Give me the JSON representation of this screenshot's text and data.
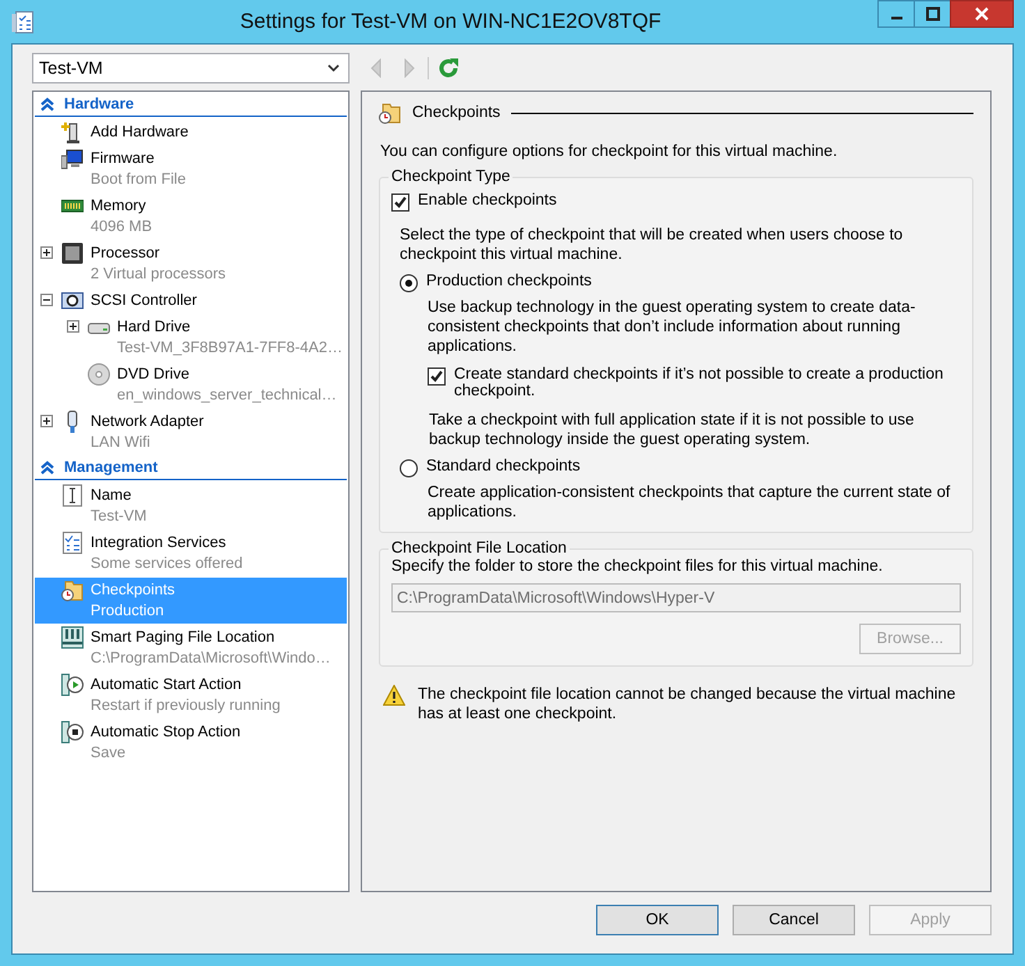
{
  "window": {
    "title": "Settings for Test-VM on WIN-NC1E2OV8TQF"
  },
  "vm_selector": {
    "value": "Test-VM"
  },
  "sidebar": {
    "sections": [
      {
        "title": "Hardware",
        "expanded": true,
        "items": [
          {
            "kind": "add",
            "label": "Add Hardware",
            "selected": false
          },
          {
            "kind": "firmware",
            "label": "Firmware",
            "detail": "Boot from File",
            "selected": false
          },
          {
            "kind": "memory",
            "label": "Memory",
            "detail": "4096 MB",
            "selected": false
          },
          {
            "kind": "processor",
            "label": "Processor",
            "detail": "2 Virtual processors",
            "selected": false,
            "expanded": false
          },
          {
            "kind": "controller",
            "label": "SCSI Controller",
            "selected": false,
            "expanded": true,
            "children": [
              {
                "kind": "disk",
                "label": "Hard Drive",
                "detail": "Test-VM_3F8B97A1-7FF8-4A2…",
                "selected": false,
                "expanded": false
              },
              {
                "kind": "dvd",
                "label": "DVD Drive",
                "detail": "en_windows_server_technical…",
                "selected": false
              }
            ]
          },
          {
            "kind": "network",
            "label": "Network Adapter",
            "detail": "LAN Wifi",
            "selected": false,
            "expanded": false
          }
        ]
      },
      {
        "title": "Management",
        "expanded": true,
        "items": [
          {
            "kind": "name",
            "label": "Name",
            "detail": "Test-VM",
            "selected": false
          },
          {
            "kind": "services",
            "label": "Integration Services",
            "detail": "Some services offered",
            "selected": false
          },
          {
            "kind": "checkpoint",
            "label": "Checkpoints",
            "detail": "Production",
            "selected": true
          },
          {
            "kind": "paging",
            "label": "Smart Paging File Location",
            "detail": "C:\\ProgramData\\Microsoft\\Windo…",
            "selected": false
          },
          {
            "kind": "start",
            "label": "Automatic Start Action",
            "detail": "Restart if previously running",
            "selected": false
          },
          {
            "kind": "stop",
            "label": "Automatic Stop Action",
            "detail": "Save",
            "selected": false
          }
        ]
      }
    ]
  },
  "panel": {
    "title": "Checkpoints",
    "intro": "You can configure options for checkpoint for this virtual machine.",
    "checkpoint_type": {
      "legend": "Checkpoint Type",
      "enable": {
        "label": "Enable checkpoints",
        "checked": true
      },
      "instruction": "Select the type of checkpoint that will be created when users choose to checkpoint this virtual machine.",
      "options": [
        {
          "label": "Production checkpoints",
          "selected": true,
          "description": "Use backup technology in the guest operating system to create data-consistent checkpoints that don’t include information about running applications.",
          "sub_option": {
            "label": "Create standard checkpoints if it’s not possible to create a production checkpoint.",
            "checked": true
          },
          "note": "Take a checkpoint with full application state if it is not possible to use backup technology inside the guest operating system."
        },
        {
          "label": "Standard checkpoints",
          "selected": false,
          "description": "Create application-consistent checkpoints that capture the current state of applications."
        }
      ]
    },
    "file_location": {
      "legend": "Checkpoint File Location",
      "instruction": "Specify the folder to store the checkpoint files for this virtual machine.",
      "path": {
        "value": "C:\\ProgramData\\Microsoft\\Windows\\Hyper-V",
        "disabled": true
      },
      "browse": {
        "label": "Browse...",
        "disabled": true
      }
    },
    "warning": "The checkpoint file location cannot be changed because the virtual machine has at least one checkpoint."
  },
  "buttons": [
    {
      "label": "OK",
      "default": true,
      "disabled": false
    },
    {
      "label": "Cancel",
      "default": false,
      "disabled": false
    },
    {
      "label": "Apply",
      "default": false,
      "disabled": true
    }
  ]
}
